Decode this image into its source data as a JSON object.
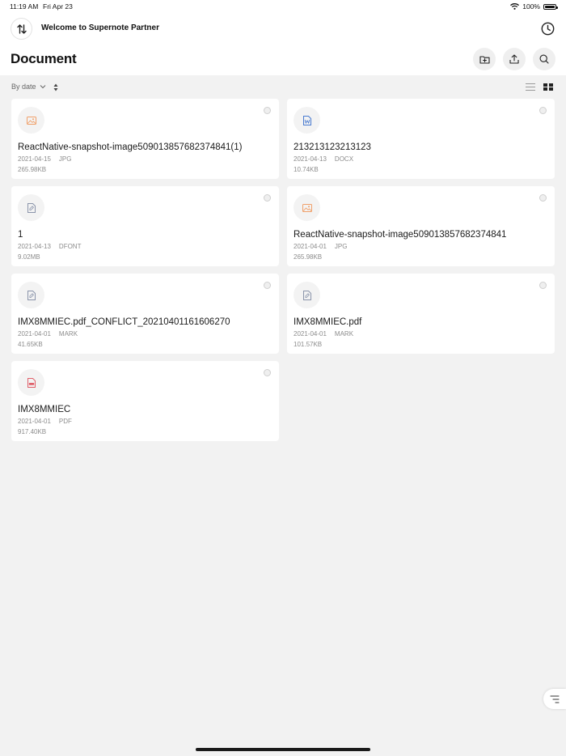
{
  "status_bar": {
    "time": "11:19 AM",
    "date": "Fri Apr 23",
    "battery": "100%"
  },
  "header": {
    "app_title": "Welcome to Supernote Partner"
  },
  "page": {
    "title": "Document"
  },
  "toolbar": {
    "sort_label": "By date"
  },
  "files": [
    {
      "name": "ReactNative-snapshot-image509013857682374841(1)",
      "date": "2021-04-15",
      "type": "JPG",
      "size": "265.98KB",
      "icon": "image-file-icon"
    },
    {
      "name": "213213123213123",
      "date": "2021-04-13",
      "type": "DOCX",
      "size": "10.74KB",
      "icon": "word-file-icon"
    },
    {
      "name": "1",
      "date": "2021-04-13",
      "type": "DFONT",
      "size": "9.02MB",
      "icon": "generic-file-icon"
    },
    {
      "name": "ReactNative-snapshot-image509013857682374841",
      "date": "2021-04-01",
      "type": "JPG",
      "size": "265.98KB",
      "icon": "image-file-icon"
    },
    {
      "name": "IMX8MMIEC.pdf_CONFLICT_20210401161606270",
      "date": "2021-04-01",
      "type": "MARK",
      "size": "41.65KB",
      "icon": "generic-file-icon"
    },
    {
      "name": "IMX8MMIEC.pdf",
      "date": "2021-04-01",
      "type": "MARK",
      "size": "101.57KB",
      "icon": "generic-file-icon"
    },
    {
      "name": "IMX8MMIEC",
      "date": "2021-04-01",
      "type": "PDF",
      "size": "917.40KB",
      "icon": "pdf-file-icon"
    }
  ],
  "colors": {
    "image_icon": "#f0a06a",
    "word_icon": "#4a7bd0",
    "generic_icon": "#8a94aa",
    "pdf_icon": "#e0606a"
  }
}
